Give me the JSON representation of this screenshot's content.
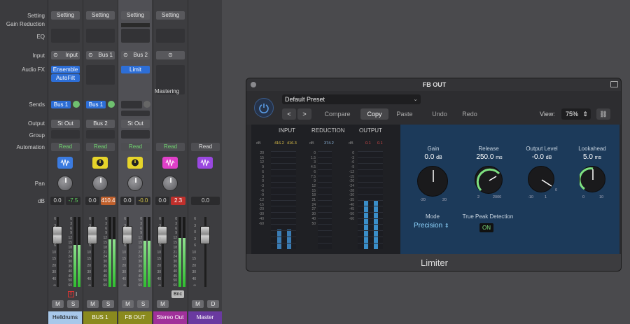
{
  "row_labels": [
    "Setting",
    "Gain Reduction",
    "EQ",
    "Input",
    "Audio FX",
    "Sends",
    "Output",
    "Group",
    "Automation",
    "Pan",
    "dB"
  ],
  "strips": [
    {
      "setting": "Setting",
      "input": "Input",
      "fx": [
        "Ensemble",
        "AutoFilt"
      ],
      "send": "Bus 1",
      "output": "St Out",
      "automation": "Read",
      "icon_color": "#3b7be0",
      "vol": "0.0",
      "peak": "-7.5",
      "peak_color": "#5fd05f",
      "ms": [
        "M",
        "S"
      ],
      "indicators": [
        "0",
        "I"
      ],
      "name": "Helldrums",
      "name_color": "#a8c8ea",
      "name_text_color": "#111",
      "meter_level": 0.6
    },
    {
      "setting": "Setting",
      "input": "Bus 1",
      "fx": [],
      "send": "Bus 1",
      "output": "Bus 2",
      "automation": "Read",
      "icon_color": "#e6d42a",
      "vol": "0.0",
      "peak": "410.4",
      "peak_color": "#c0602c",
      "ms": [
        "M",
        "S"
      ],
      "indicators": [],
      "name": "BUS 1",
      "name_color": "#8a8a1e",
      "name_text_color": "#fff",
      "meter_level": 0.68
    },
    {
      "setting": "Setting",
      "input": "Bus 2",
      "fx": [
        "Limit"
      ],
      "send": "",
      "output": "St Out",
      "automation": "Read",
      "icon_color": "#e6d42a",
      "vol": "0.0",
      "peak": "-0.0",
      "peak_color": "#d8c84a",
      "ms": [
        "M",
        "S"
      ],
      "indicators": [],
      "name": "FB OUT",
      "name_color": "#8a8a1e",
      "name_text_color": "#fff",
      "meter_level": 0.66
    },
    {
      "setting": "Setting",
      "input": "",
      "fx": [],
      "mastering": "Mastering",
      "send": "",
      "output": "",
      "automation": "Read",
      "icon_color": "#e040c8",
      "vol": "0.0",
      "peak": "2.3",
      "peak_color": "#c0302c",
      "ms": [
        "M"
      ],
      "indicators": [
        "Bnc"
      ],
      "name": "Stereo Out",
      "name_color": "#a0309a",
      "name_text_color": "#fff",
      "meter_level": 0.7
    },
    {
      "setting": "",
      "input": "",
      "fx": [],
      "send": "",
      "output": "",
      "automation": "Read",
      "icon_color": "#9a48e0",
      "vol": "0.0",
      "peak": "",
      "peak_color": "#333",
      "ms": [
        "M",
        "D"
      ],
      "indicators": [],
      "name": "Master",
      "name_color": "#6a3aa0",
      "name_text_color": "#fff",
      "meter_level": 0
    }
  ],
  "fader_scale": [
    "6",
    "3",
    "0",
    "3",
    "6",
    "10",
    "15",
    "20",
    "30",
    "40",
    "∞"
  ],
  "meter_scale": [
    "0",
    "3",
    "6",
    "9",
    "12",
    "15",
    "18",
    "21",
    "24",
    "30",
    "35",
    "40",
    "45",
    "50",
    "60"
  ],
  "plugin": {
    "title": "FB OUT",
    "preset": "Default Preset",
    "buttons": {
      "prev": "<",
      "next": ">",
      "compare": "Compare",
      "copy": "Copy",
      "paste": "Paste",
      "undo": "Undo",
      "redo": "Redo"
    },
    "view_label": "View:",
    "view_value": "75%",
    "meters": {
      "input_label": "INPUT",
      "reduction_label": "REDUCTION",
      "output_label": "OUTPUT",
      "input_peaks": [
        "416.2",
        "416.3"
      ],
      "reduction_peak": "374.2",
      "output_peaks": [
        "0.1",
        "0.1"
      ],
      "db_label": "dB",
      "input_scale": [
        "20",
        "15",
        "12",
        "9",
        "6",
        "3",
        "0",
        "-3",
        "-6",
        "-9",
        "-12",
        "-15",
        "-20",
        "-30",
        "-40",
        "-60"
      ],
      "reduction_scale": [
        "0",
        "1.5",
        "3",
        "4.5",
        "6",
        "7.5",
        "9",
        "12",
        "15",
        "18",
        "21",
        "24",
        "27",
        "30",
        "40",
        "50"
      ],
      "output_scale": [
        "0",
        "-3",
        "-6",
        "-9",
        "-12",
        "-15",
        "-20",
        "-24",
        "-28",
        "-30",
        "-35",
        "-40",
        "-45",
        "-50",
        "-60"
      ],
      "input_level": 0.2,
      "output_level": 0.5
    },
    "gain": {
      "label": "Gain",
      "value": "0.0",
      "unit": "dB",
      "min": "-20",
      "max": "20"
    },
    "release": {
      "label": "Release",
      "value": "250.0",
      "unit": "ms",
      "min": "2",
      "max": "2000"
    },
    "output_level": {
      "label": "Output Level",
      "value": "-0.0",
      "unit": "dB",
      "min": "-10",
      "max": "1",
      "mid": "0"
    },
    "lookahead": {
      "label": "Lookahead",
      "value": "5.0",
      "unit": "ms",
      "min": "0",
      "max": "10"
    },
    "mode_label": "Mode",
    "mode_value": "Precision",
    "tpd_label": "True Peak Detection",
    "tpd_value": "ON",
    "footer": "Limiter"
  }
}
